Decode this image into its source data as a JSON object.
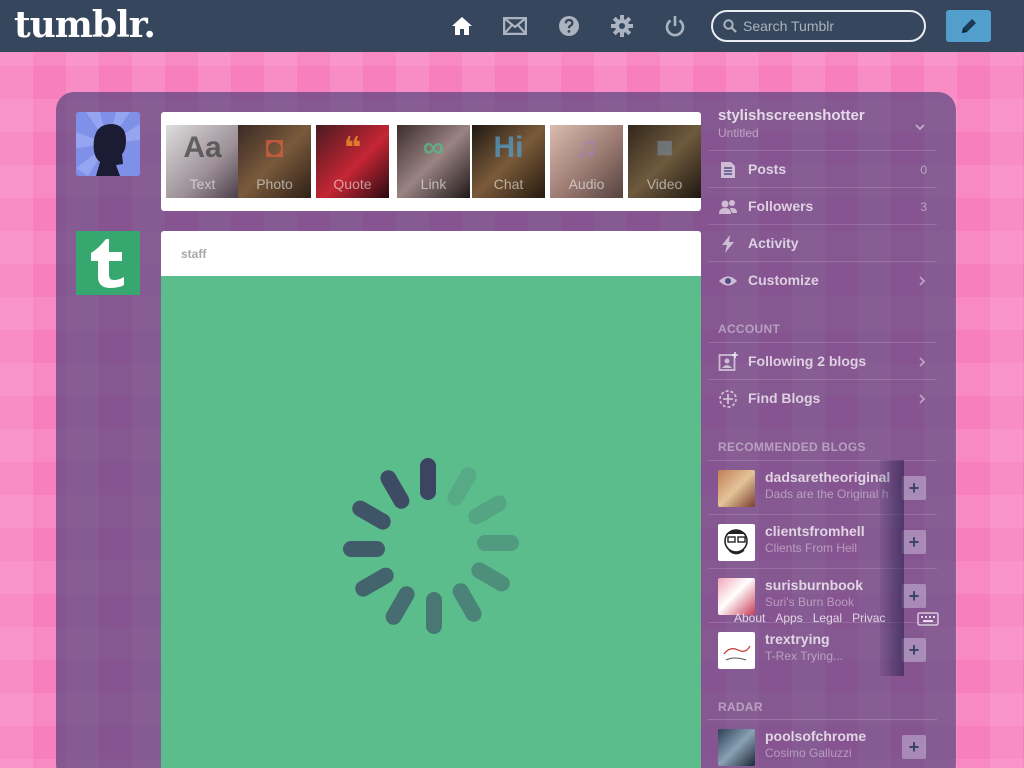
{
  "header": {
    "logo": "tumblr.",
    "search": {
      "placeholder": "Search Tumblr",
      "value": ""
    },
    "nav_icons": [
      "home-icon",
      "mail-icon",
      "help-icon",
      "gear-icon",
      "power-icon"
    ],
    "compose_icon": "pencil-icon"
  },
  "colors": {
    "header_bg": "#36465d",
    "compose_blue": "#529ecc",
    "post_green": "#5bbd8c",
    "background_pink": "#f77fbe",
    "staff_avatar": "#37a770"
  },
  "post_types": [
    {
      "label": "Text",
      "glyph": "Aa",
      "color": "#444444"
    },
    {
      "label": "Photo",
      "glyph": "◘",
      "color": "#d95e40"
    },
    {
      "label": "Quote",
      "glyph": "❝",
      "color": "#f2992e"
    },
    {
      "label": "Link",
      "glyph": "∞",
      "color": "#56bc8a"
    },
    {
      "label": "Chat",
      "glyph": "Hi",
      "color": "#529ecc"
    },
    {
      "label": "Audio",
      "glyph": "♫",
      "color": "#a77dc2"
    },
    {
      "label": "Video",
      "glyph": "■",
      "color": "#748089"
    }
  ],
  "post": {
    "author": "staff"
  },
  "sidebar": {
    "blog": {
      "name": "stylishscreenshotter",
      "title": "Untitled"
    },
    "menu": [
      {
        "label": "Posts",
        "count": "0",
        "icon": "document-icon"
      },
      {
        "label": "Followers",
        "count": "3",
        "icon": "people-icon"
      },
      {
        "label": "Activity",
        "count": "",
        "icon": "lightning-icon"
      },
      {
        "label": "Customize",
        "count": "",
        "icon": "eye-icon"
      }
    ],
    "account_heading": "ACCOUNT",
    "account": [
      {
        "label": "Following 2 blogs",
        "icon": "following-icon"
      },
      {
        "label": "Find Blogs",
        "icon": "compass-icon"
      }
    ],
    "recommended_heading": "RECOMMENDED BLOGS",
    "recommended": [
      {
        "name": "dadsaretheoriginal",
        "title": "Dads are the Original h"
      },
      {
        "name": "clientsfromhell",
        "title": "Clients From Hell"
      },
      {
        "name": "surisburnbook",
        "title": "Suri's Burn Book"
      },
      {
        "name": "trextrying",
        "title": "T-Rex Trying..."
      }
    ],
    "radar_heading": "RADAR",
    "radar": [
      {
        "name": "poolsofchrome",
        "title": "Cosimo Galluzzi"
      }
    ]
  },
  "footer": {
    "links": [
      "About",
      "Apps",
      "Legal",
      "Privac"
    ]
  }
}
